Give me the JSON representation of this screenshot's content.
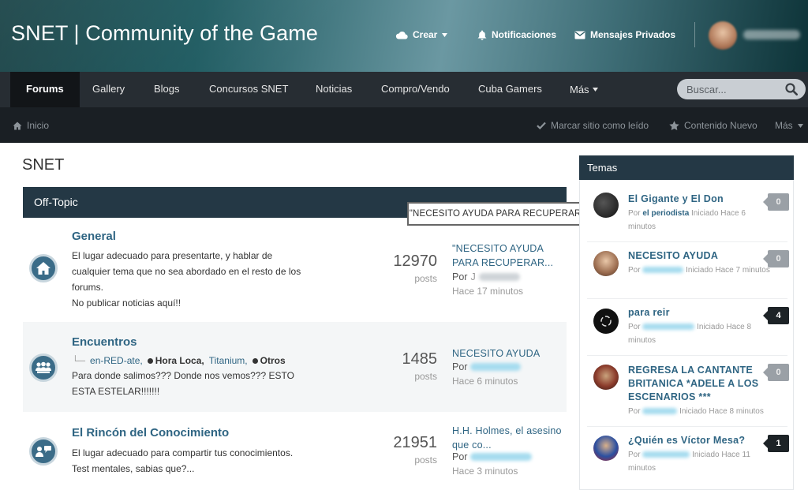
{
  "header": {
    "site_title": "SNET | Community of the Game",
    "crear": "Crear",
    "notificaciones": "Notificaciones",
    "mensajes": "Mensajes Privados"
  },
  "nav": {
    "items": [
      "Forums",
      "Gallery",
      "Blogs",
      "Concursos SNET",
      "Noticias",
      "Compro/Vendo",
      "Cuba Gamers",
      "Más"
    ],
    "search_placeholder": "Buscar..."
  },
  "subnav": {
    "inicio": "Inicio",
    "marcar": "Marcar sitio como leído",
    "contenido": "Contenido Nuevo",
    "mas": "Más"
  },
  "main": {
    "page_title": "SNET",
    "category": "Off-Topic",
    "tooltip": "\"NECESITO AYUDA PARA RECUPERAR UN AMIGO\"",
    "forums": [
      {
        "name": "General",
        "description_lines": [
          "El lugar adecuado para presentarte, y hablar de",
          "cualquier tema que no sea abordado en el resto de los",
          "forums.",
          "No publicar noticias aquí!!"
        ],
        "count": "12970",
        "count_label": "posts",
        "last_title": "\"NECESITO AYUDA PARA RECUPERAR...",
        "by_label": "Por",
        "by_initial": "J",
        "last_time": "Hace 17 minutos"
      },
      {
        "name": "Encuentros",
        "subforums": [
          "en-RED-ate,",
          "Hora Loca,",
          "Titanium,",
          "Otros"
        ],
        "description_lines": [
          "Para donde salimos??? Donde nos vemos??? ESTO",
          "ESTA ESTELAR!!!!!!!"
        ],
        "count": "1485",
        "count_label": "posts",
        "last_title": "NECESITO AYUDA",
        "by_label": "Por",
        "last_time": "Hace 6 minutos"
      },
      {
        "name": "El Rincón del Conocimiento",
        "description_lines": [
          "El lugar adecuado para compartir tus conocimientos.",
          "Test mentales, sabias que?..."
        ],
        "count": "21951",
        "count_label": "posts",
        "last_title": "H.H. Holmes, el asesino que co...",
        "by_label": "Por",
        "last_time": "Hace 3 minutos"
      }
    ]
  },
  "sidebar": {
    "title": "Temas",
    "topics": [
      {
        "title": "El Gigante y El Don",
        "meta_prefix": "Por",
        "author": "el periodista",
        "meta": "Iniciado Hace 6 minutos",
        "count": "0",
        "badge": "gray"
      },
      {
        "title": "NECESITO AYUDA",
        "meta_prefix": "Por",
        "author": "",
        "meta": "Iniciado Hace 7 minutos",
        "count": "0",
        "badge": "gray"
      },
      {
        "title": "para reir",
        "meta_prefix": "Por",
        "author": "",
        "meta": "Iniciado Hace 8 minutos",
        "count": "4",
        "badge": "dark"
      },
      {
        "title": "REGRESA LA CANTANTE BRITANICA *ADELE A LOS ESCENARIOS ***",
        "meta_prefix": "Por",
        "author": "",
        "meta": "Iniciado Hace 8 minutos",
        "count": "0",
        "badge": "gray"
      },
      {
        "title": "¿Quién es Víctor Mesa?",
        "meta_prefix": "Por",
        "author": "",
        "meta": "Iniciado Hace 11 minutos",
        "count": "1",
        "badge": "dark"
      }
    ]
  },
  "colors": {
    "accent": "#2f6583",
    "nav_bg": "#272d33",
    "category_bg": "#243845"
  }
}
